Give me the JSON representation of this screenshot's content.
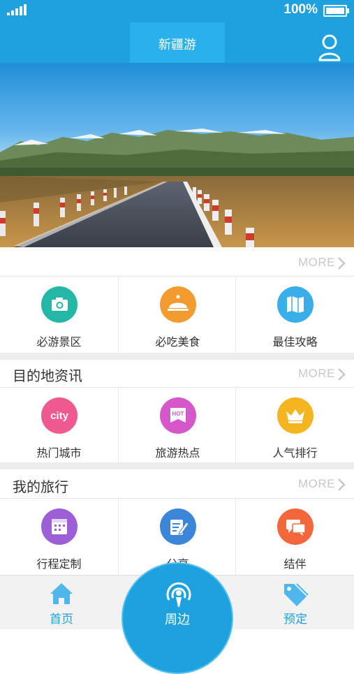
{
  "status_bar": {
    "battery": "100%"
  },
  "header": {
    "title": "新疆游"
  },
  "quick_more": "MORE",
  "quick_grid": [
    {
      "label": "必游景区",
      "icon": "camera-icon",
      "color": "#25b7a6"
    },
    {
      "label": "必吃美食",
      "icon": "dining-bell-icon",
      "color": "#f29b2f"
    },
    {
      "label": "最佳攻略",
      "icon": "map-icon",
      "color": "#3aaee8"
    }
  ],
  "destination_news": {
    "title": "目的地资讯",
    "more": "MORE",
    "items": [
      {
        "label": "热门城市",
        "icon": "city-icon",
        "icon_text": "city",
        "color": "#ef5b8f"
      },
      {
        "label": "旅游热点",
        "icon": "hot-icon",
        "icon_text": "HOT",
        "color": "#d657c9"
      },
      {
        "label": "人气排行",
        "icon": "crown-icon",
        "color": "#f4b520"
      }
    ]
  },
  "my_trip": {
    "title": "我的旅行",
    "more": "MORE",
    "items": [
      {
        "label": "行程定制",
        "icon": "calendar-icon",
        "color": "#9c5fd6"
      },
      {
        "label": "分享",
        "icon": "edit-share-icon",
        "color": "#3b86d8"
      },
      {
        "label": "结伴",
        "icon": "chat-icon",
        "color": "#f4673c"
      }
    ]
  },
  "bottom_nav": {
    "home": "首页",
    "nearby": "周边",
    "booking": "预定"
  }
}
